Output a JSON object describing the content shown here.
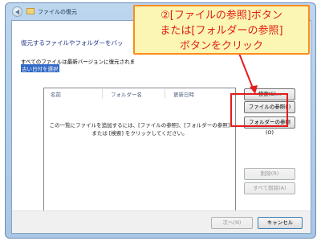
{
  "window": {
    "title": "ファイルの復元"
  },
  "main": {
    "heading": "復元するファイルやフォルダーをバッ",
    "info": "すべてのファイルは最新バージョンに復元されま",
    "link": "古い日付を選択"
  },
  "list": {
    "columns": [
      "名前",
      "フォルダー名",
      "更新日時"
    ],
    "empty_message_line1": "この一覧にファイルを追加するには、[ファイルの参照]、[フォルダーの参照]",
    "empty_message_line2": "または [検索] をクリックしてください。"
  },
  "buttons": {
    "search": "検索(S)...",
    "browse_files": "ファイルの参照(I)",
    "browse_folders": "フォルダーの参照(O)",
    "remove": "削除(R)",
    "remove_all": "すべて削除(A)",
    "next": "次へ(N)",
    "cancel": "キャンセル"
  },
  "callout": {
    "line1": "②[ファイルの参照]ボタン",
    "line2": "または[フォルダーの参照]",
    "line3": "ボタンをクリック"
  },
  "colors": {
    "callout_text": "#e22016",
    "callout_border": "#ff8a1c",
    "callout_fill": "#fbf6b3",
    "highlight": "#e31c1c",
    "link_background": "#3169c6"
  }
}
